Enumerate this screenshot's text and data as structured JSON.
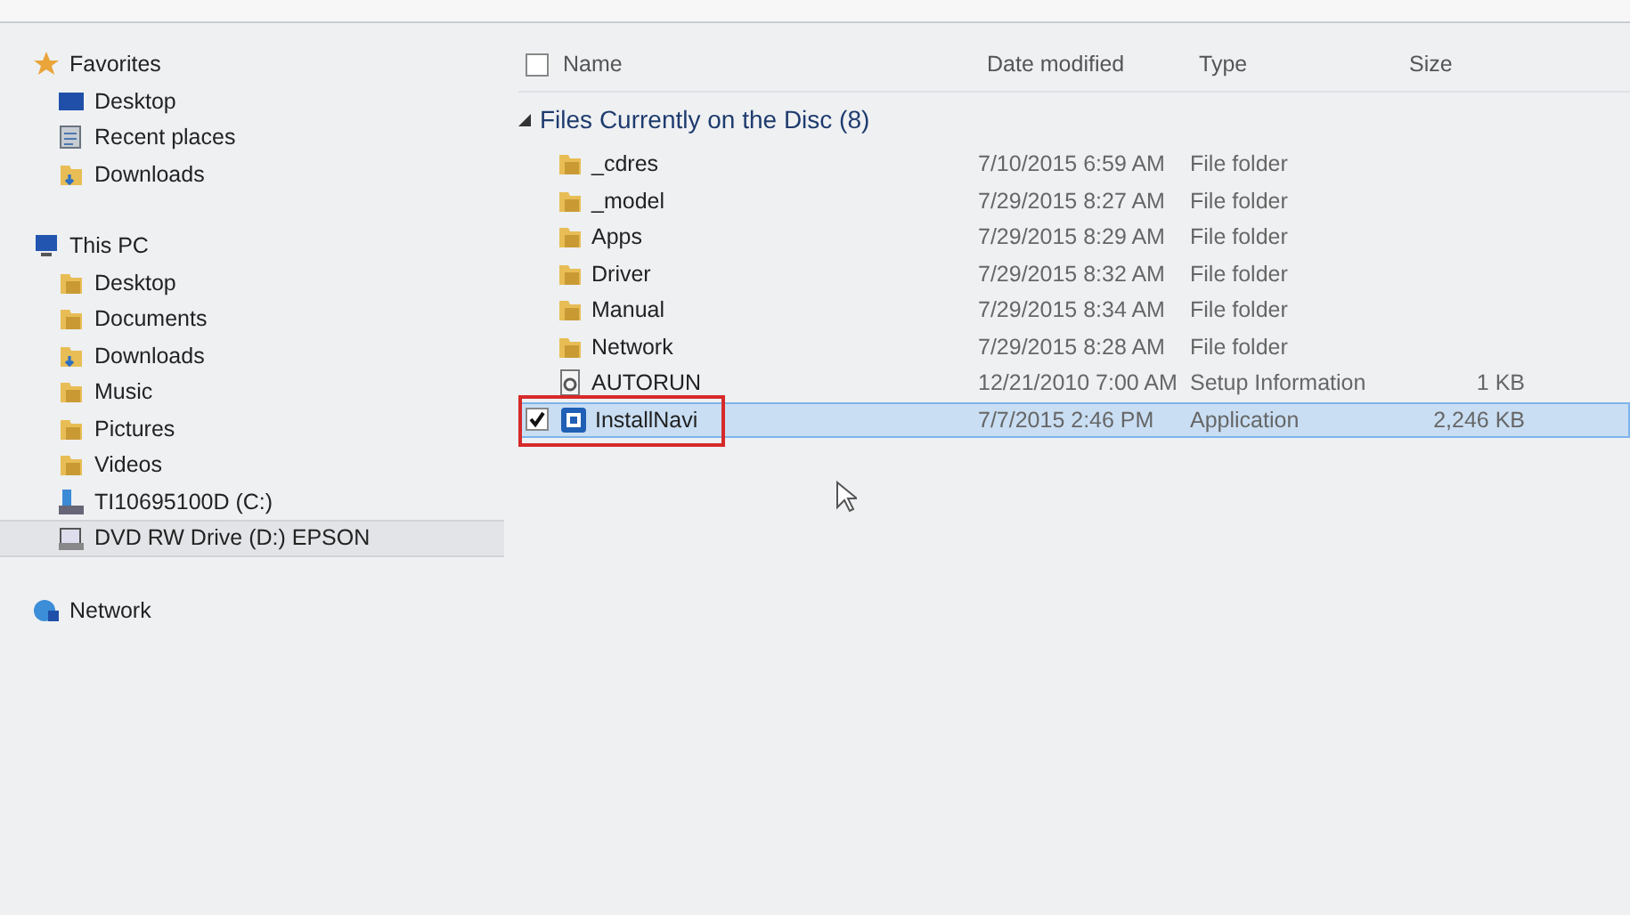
{
  "navigation": [
    {
      "label": "Favorites",
      "kind": "star",
      "selected": false,
      "children": [
        {
          "label": "Desktop",
          "kind": "desktop",
          "selected": false
        },
        {
          "label": "Recent places",
          "kind": "recent",
          "selected": false
        },
        {
          "label": "Downloads",
          "kind": "download-folder",
          "selected": false
        }
      ]
    },
    {
      "label": "This PC",
      "kind": "pc",
      "selected": false,
      "children": [
        {
          "label": "Desktop",
          "kind": "folder",
          "selected": false
        },
        {
          "label": "Documents",
          "kind": "folder",
          "selected": false
        },
        {
          "label": "Downloads",
          "kind": "download-folder",
          "selected": false
        },
        {
          "label": "Music",
          "kind": "folder",
          "selected": false
        },
        {
          "label": "Pictures",
          "kind": "folder",
          "selected": false
        },
        {
          "label": "Videos",
          "kind": "folder",
          "selected": false
        },
        {
          "label": "TI10695100D (C:)",
          "kind": "drive",
          "selected": false
        },
        {
          "label": "DVD RW Drive (D:) EPSON",
          "kind": "dvd",
          "selected": true
        }
      ]
    },
    {
      "label": "Network",
      "kind": "network",
      "selected": false
    }
  ],
  "file_list": {
    "columns": [
      "Name",
      "Date modified",
      "Type",
      "Size"
    ],
    "select_all_checked": false,
    "group": {
      "title": "Files Currently on the Disc (8)",
      "expanded": true
    },
    "rows": [
      {
        "name": "_cdres",
        "date": "7/10/2015 6:59 AM",
        "type": "File folder",
        "kind": "folder",
        "selected": false,
        "checked": false,
        "annotated": false
      },
      {
        "name": "_model",
        "date": "7/29/2015 8:27 AM",
        "type": "File folder",
        "kind": "folder",
        "selected": false,
        "checked": false,
        "annotated": false
      },
      {
        "name": "Apps",
        "date": "7/29/2015 8:29 AM",
        "type": "File folder",
        "kind": "folder",
        "selected": false,
        "checked": false,
        "annotated": false
      },
      {
        "name": "Driver",
        "date": "7/29/2015 8:32 AM",
        "type": "File folder",
        "kind": "folder",
        "selected": false,
        "checked": false,
        "annotated": false
      },
      {
        "name": "Manual",
        "date": "7/29/2015 8:34 AM",
        "type": "File folder",
        "kind": "folder",
        "selected": false,
        "checked": false,
        "annotated": false
      },
      {
        "name": "Network",
        "date": "7/29/2015 8:28 AM",
        "type": "File folder",
        "kind": "folder",
        "selected": false,
        "checked": false,
        "annotated": false
      },
      {
        "name": "AUTORUN",
        "date": "12/21/2010 7:00 AM",
        "type": "Setup Information",
        "size": "1 KB",
        "kind": "settings",
        "selected": false,
        "checked": false,
        "annotated": false
      },
      {
        "name": "InstallNavi",
        "date": "7/7/2015 2:46 PM",
        "type": "Application",
        "size": "2,246 KB",
        "kind": "application",
        "selected": true,
        "checked": true,
        "annotated": true
      }
    ]
  }
}
